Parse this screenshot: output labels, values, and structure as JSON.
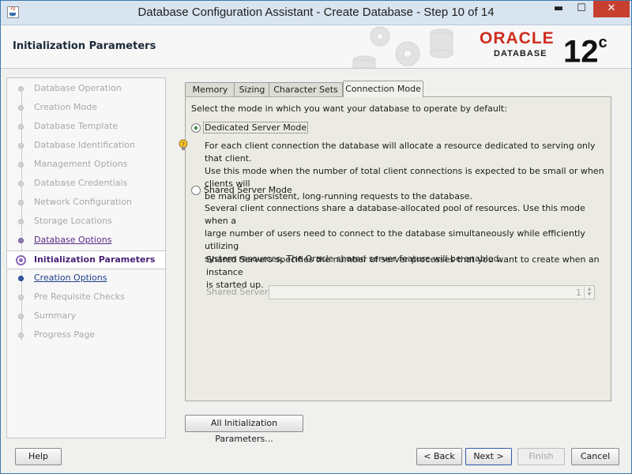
{
  "window": {
    "title": "Database Configuration Assistant - Create Database - Step 10 of 14",
    "controls": {
      "minimize": "▬",
      "maximize": "☐",
      "close": "✕"
    }
  },
  "header": {
    "page_title": "Initialization Parameters",
    "logo_brand": "ORACLE",
    "logo_product": "DATABASE",
    "logo_version": "12",
    "logo_version_suffix": "c"
  },
  "sidebar": {
    "steps": [
      {
        "label": "Database Operation",
        "state": "done"
      },
      {
        "label": "Creation Mode",
        "state": "done"
      },
      {
        "label": "Database Template",
        "state": "done"
      },
      {
        "label": "Database Identification",
        "state": "done"
      },
      {
        "label": "Management Options",
        "state": "done"
      },
      {
        "label": "Database Credentials",
        "state": "done"
      },
      {
        "label": "Network Configuration",
        "state": "done"
      },
      {
        "label": "Storage Locations",
        "state": "done"
      },
      {
        "label": "Database Options",
        "state": "visited"
      },
      {
        "label": "Initialization Parameters",
        "state": "current"
      },
      {
        "label": "Creation Options",
        "state": "link"
      },
      {
        "label": "Pre Requisite Checks",
        "state": "pending"
      },
      {
        "label": "Summary",
        "state": "pending"
      },
      {
        "label": "Progress Page",
        "state": "pending"
      }
    ]
  },
  "tabs": [
    {
      "label": "Memory",
      "active": false
    },
    {
      "label": "Sizing",
      "active": false
    },
    {
      "label": "Character Sets",
      "active": false
    },
    {
      "label": "Connection Mode",
      "active": true
    }
  ],
  "connection_mode": {
    "intro": "Select the mode in which you want your database to operate by default:",
    "dedicated": {
      "label": "Dedicated Server Mode",
      "selected": true,
      "description_lines": [
        "For each client connection the database will allocate a resource dedicated to serving only that client.",
        "Use this mode when the number of total client connections is expected to be small or when clients will",
        "be making persistent, long-running requests to the database."
      ]
    },
    "shared": {
      "label": "Shared Server Mode",
      "selected": false,
      "description_lines": [
        "Several client connections share a database-allocated pool of resources.  Use this mode when a",
        "large number of users need to connect to the database simultaneously while efficiently utilizing",
        "system resources.  The Oracle shared server feature will be enabled."
      ],
      "servers_note_lines": [
        "Shared Servers specifies the number of server processes that you want to create when an instance",
        "is started up."
      ],
      "spinner_label": "Shared Server:",
      "spinner_value": "1"
    }
  },
  "buttons": {
    "all_params": "All Initialization Parameters...",
    "help": "Help",
    "back": "< Back",
    "next": "Next >",
    "finish": "Finish",
    "cancel": "Cancel"
  },
  "colors": {
    "oracle_red": "#d02c1f",
    "visited_step": "#5a2d86",
    "link_step": "#1e3f8a",
    "close_button": "#c7402f"
  }
}
